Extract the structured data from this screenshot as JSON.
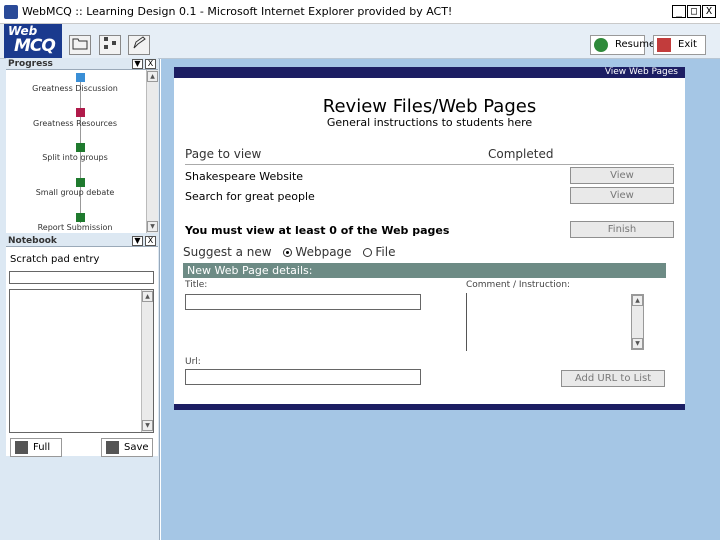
{
  "window": {
    "title": "WebMCQ :: Learning Design 0.1 - Microsoft Internet Explorer provided by ACT!",
    "controls": {
      "minimize": "_",
      "maximize": "□",
      "close": "X"
    }
  },
  "header": {
    "logo": {
      "line1": "Web",
      "line2": "MCQ"
    },
    "toolbar_icons": [
      "folder-icon",
      "hierarchy-icon",
      "notepad-icon"
    ],
    "resume_label": "Resume",
    "exit_label": "Exit"
  },
  "progress": {
    "title": "Progress",
    "steps": [
      {
        "label": "Greatness Discussion",
        "color": "#3a8fd6"
      },
      {
        "label": "Greatness Resources",
        "color": "#b01a4a"
      },
      {
        "label": "Split into groups",
        "color": "#1f7a2e"
      },
      {
        "label": "Small group debate",
        "color": "#1f7a2e"
      },
      {
        "label": "Report Submission",
        "color": "#1f7a2e"
      }
    ]
  },
  "notebook": {
    "title": "Notebook",
    "entry_label": "Scratch pad entry",
    "entry_value": "",
    "full_label": "Full",
    "save_label": "Save"
  },
  "main": {
    "top_link": "View Web Pages",
    "title": "Review Files/Web Pages",
    "subtitle": "General instructions to students here",
    "col_page": "Page to view",
    "col_completed": "Completed",
    "rows": [
      {
        "name": "Shakespeare Website",
        "button": "View"
      },
      {
        "name": "Search for great people",
        "button": "View"
      }
    ],
    "must_view": "You must view at least 0 of the Web pages",
    "finish_label": "Finish",
    "suggest_label": "Suggest a new",
    "opt_webpage": "Webpage",
    "opt_file": "File",
    "new_header": "New Web Page details:",
    "title_label": "Title:",
    "comment_label": "Comment / Instruction:",
    "url_label": "Url:",
    "add_url_label": "Add URL to List"
  }
}
